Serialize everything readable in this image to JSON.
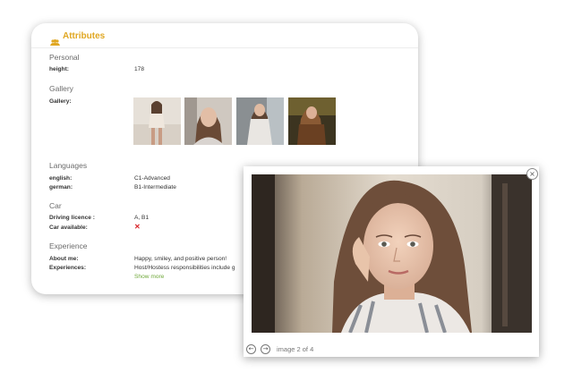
{
  "attributes": {
    "title": "Attributes",
    "icon": "users-icon",
    "accent_color": "#e0a722",
    "personal": {
      "heading": "Personal",
      "height_label": "height:",
      "height_value": "178"
    },
    "gallery": {
      "heading": "Gallery",
      "label": "Gallery:",
      "thumbnail_count": 4
    },
    "languages": {
      "heading": "Languages",
      "items": [
        {
          "label": "english:",
          "value": "C1-Advanced"
        },
        {
          "label": "german:",
          "value": "B1-Intermediate"
        }
      ]
    },
    "car": {
      "heading": "Car",
      "licence_label": "Driving licence :",
      "licence_value": "A, B1",
      "available_label": "Car available:",
      "available_icon": "cross-icon",
      "available_symbol": "✕",
      "available_color": "#d9252a"
    },
    "experience": {
      "heading": "Experience",
      "about_label": "About me:",
      "about_value": "Happy, smiley, and positive person!",
      "experiences_label": "Experiences:",
      "experiences_value": "Host/Hostess responsibilities include g",
      "show_more": "Show more",
      "link_color": "#6fa83a"
    }
  },
  "lightbox": {
    "close_symbol": "×",
    "prev_symbol": "←",
    "next_symbol": "→",
    "counter": "image 2 of 4",
    "current_image": 2,
    "total_images": 4
  }
}
